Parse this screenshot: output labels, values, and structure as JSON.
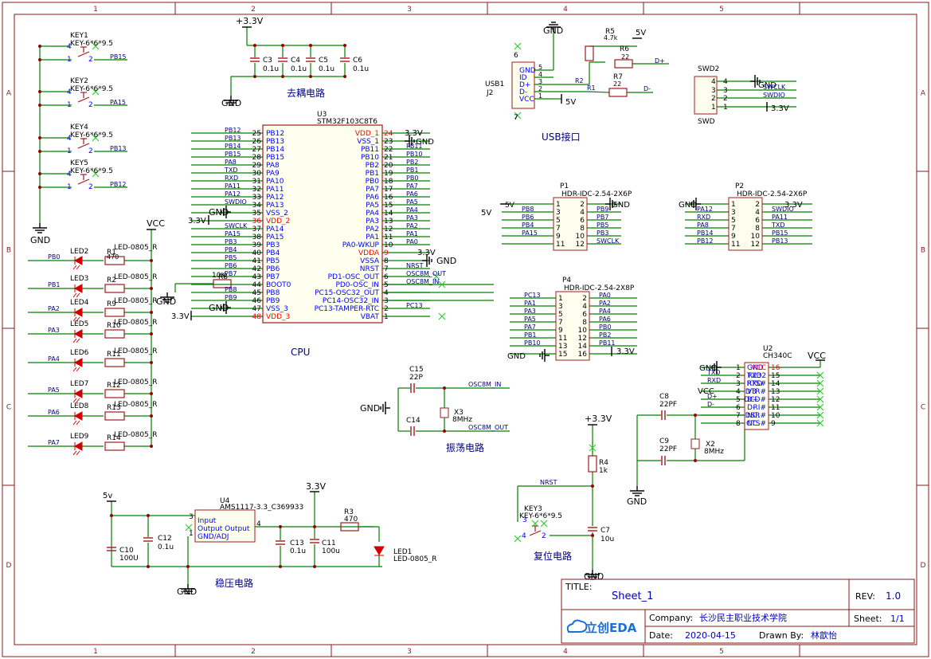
{
  "colors": {
    "frame": "#8b1a1a",
    "wire": "#008000",
    "part": "#a11b1b",
    "pin": "#0000ff",
    "text": "#000000",
    "netlabel": "#000080",
    "power_red": "#ff0000",
    "noconnect": "#33cc33",
    "logo": "#1b6fd6"
  },
  "border": {
    "cols": [
      "1",
      "2",
      "3",
      "4",
      "5"
    ],
    "rows": [
      "A",
      "B",
      "C",
      "D"
    ]
  },
  "title_block": {
    "title_label": "TITLE:",
    "title": "Sheet_1",
    "rev_label": "REV:",
    "rev": "1.0",
    "company_label": "Company:",
    "company": "长沙民主职业技术学院",
    "sheet_label": "Sheet:",
    "sheet": "1/1",
    "date_label": "Date:",
    "date": "2020-04-15",
    "drawn_label": "Drawn By:",
    "drawn_by": "林歆怡",
    "logo_text": "立创EDA"
  },
  "sections": {
    "decoupling": "去耦电路",
    "cpu": "CPU",
    "usb": "USB接口",
    "oscillator": "振荡电路",
    "regulator": "稳压电路",
    "reset": "复位电路"
  },
  "keys": [
    {
      "ref": "KEY1",
      "value": "KEY-6*6*9.5",
      "net": "PB15"
    },
    {
      "ref": "KEY2",
      "value": "KEY-6*6*9.5",
      "net": "PA15"
    },
    {
      "ref": "KEY4",
      "value": "KEY-6*6*9.5",
      "net": "PB13"
    },
    {
      "ref": "KEY5",
      "value": "KEY-6*6*9.5",
      "net": "PB12"
    }
  ],
  "key_gnd": "GND",
  "leds": [
    {
      "ref": "LED2",
      "value": "LED-0805_R",
      "res": "R1",
      "rval": "470",
      "net": "PB0"
    },
    {
      "ref": "LED3",
      "value": "LED-0805_R",
      "res": "R2",
      "rval": "",
      "net": "PB1"
    },
    {
      "ref": "LED4",
      "value": "LED-0805_R",
      "res": "R9",
      "rval": "",
      "net": "PA2"
    },
    {
      "ref": "LED5",
      "value": "LED-0805_R",
      "res": "R10",
      "rval": "",
      "net": "PA3"
    },
    {
      "ref": "LED6",
      "value": "LED-0805_R",
      "res": "R11",
      "rval": "",
      "net": "PA4"
    },
    {
      "ref": "LED7",
      "value": "LED-0805_R",
      "res": "R12",
      "rval": "",
      "net": "PA5"
    },
    {
      "ref": "LED8",
      "value": "LED-0805_R",
      "res": "R13",
      "rval": "",
      "net": "PA6"
    },
    {
      "ref": "LED9",
      "value": "LED-0805_R",
      "res": "R14",
      "rval": "",
      "net": "PA7"
    }
  ],
  "led_vcc": "VCC",
  "caps_decoupling": [
    {
      "ref": "C3",
      "value": "0.1u"
    },
    {
      "ref": "C4",
      "value": "0.1u"
    },
    {
      "ref": "C5",
      "value": "0.1u"
    },
    {
      "ref": "C6",
      "value": "0.1u"
    }
  ],
  "decoupling_power": "+3.3V",
  "decoupling_gnd": "GND",
  "cpu_chip": {
    "ref": "U3",
    "part": "STM32F103C8T6",
    "left_pins": [
      {
        "num": "25",
        "name": "PB12",
        "net": "PB12"
      },
      {
        "num": "26",
        "name": "PB13",
        "net": "PB13"
      },
      {
        "num": "27",
        "name": "PB14",
        "net": "PB14"
      },
      {
        "num": "28",
        "name": "PB15",
        "net": "PB15"
      },
      {
        "num": "29",
        "name": "PA8",
        "net": "PA8"
      },
      {
        "num": "30",
        "name": "PA9",
        "net": "TXD"
      },
      {
        "num": "31",
        "name": "PA10",
        "net": "RXD"
      },
      {
        "num": "32",
        "name": "PA11",
        "net": "PA11"
      },
      {
        "num": "33",
        "name": "PA12",
        "net": "PA12"
      },
      {
        "num": "34",
        "name": "PA13",
        "net": "SWDIO"
      },
      {
        "num": "35",
        "name": "VSS_2",
        "net": "GND"
      },
      {
        "num": "36",
        "name": "VDD_2",
        "net": "3.3V"
      },
      {
        "num": "37",
        "name": "PA14",
        "net": "SWCLK"
      },
      {
        "num": "38",
        "name": "PA15",
        "net": "PA15"
      },
      {
        "num": "39",
        "name": "PB3",
        "net": "PB3"
      },
      {
        "num": "40",
        "name": "PB4",
        "net": "PB4"
      },
      {
        "num": "41",
        "name": "PB5",
        "net": "PB5"
      },
      {
        "num": "42",
        "name": "PB6",
        "net": "PB6"
      },
      {
        "num": "43",
        "name": "PB7",
        "net": "PB7"
      },
      {
        "num": "44",
        "name": "BOOT0",
        "net": ""
      },
      {
        "num": "45",
        "name": "PB8",
        "net": "PB8"
      },
      {
        "num": "46",
        "name": "PB9",
        "net": "PB9"
      },
      {
        "num": "47",
        "name": "VSS_3",
        "net": "GND"
      },
      {
        "num": "48",
        "name": "VDD_3",
        "net": "3.3V"
      }
    ],
    "right_pins": [
      {
        "num": "24",
        "name": "VDD_1",
        "net": "3.3V"
      },
      {
        "num": "23",
        "name": "VSS_1",
        "net": "GND"
      },
      {
        "num": "22",
        "name": "PB11",
        "net": "PB11"
      },
      {
        "num": "21",
        "name": "PB10",
        "net": "PB10"
      },
      {
        "num": "20",
        "name": "PB2",
        "net": "PB2"
      },
      {
        "num": "19",
        "name": "PB1",
        "net": "PB1"
      },
      {
        "num": "18",
        "name": "PB0",
        "net": "PB0"
      },
      {
        "num": "17",
        "name": "PA7",
        "net": "PA7"
      },
      {
        "num": "16",
        "name": "PA6",
        "net": "PA6"
      },
      {
        "num": "15",
        "name": "PA5",
        "net": "PA5"
      },
      {
        "num": "14",
        "name": "PA4",
        "net": "PA4"
      },
      {
        "num": "13",
        "name": "PA3",
        "net": "PA3"
      },
      {
        "num": "12",
        "name": "PA2",
        "net": "PA2"
      },
      {
        "num": "11",
        "name": "PA1",
        "net": "PA1"
      },
      {
        "num": "10",
        "name": "PA0-WKUP",
        "net": "PA0"
      },
      {
        "num": "9",
        "name": "VDDA",
        "net": "3.3V"
      },
      {
        "num": "8",
        "name": "VSSA",
        "net": "GND"
      },
      {
        "num": "7",
        "name": "NRST",
        "net": "NRST"
      },
      {
        "num": "6",
        "name": "PD1-OSC_OUT",
        "net": "OSC8M_OUT"
      },
      {
        "num": "5",
        "name": "PD0-OSC_IN",
        "net": "OSC8M_IN"
      },
      {
        "num": "4",
        "name": "PC15-OSC32_OUT",
        "net": ""
      },
      {
        "num": "3",
        "name": "PC14-OSC32_IN",
        "net": ""
      },
      {
        "num": "2",
        "name": "PC13-TAMPER-RTC",
        "net": "PC13"
      },
      {
        "num": "1",
        "name": "VBAT",
        "net": ""
      }
    ],
    "boot_res": "R8",
    "boot_res_val": "10K",
    "gnd": "GND"
  },
  "usb": {
    "ref": "USB1",
    "conn": "J2",
    "pins": [
      {
        "num": "6",
        "name": "GND"
      },
      {
        "num": "5",
        "name": "GND"
      },
      {
        "num": "4",
        "name": "ID"
      },
      {
        "num": "3",
        "name": "D+"
      },
      {
        "num": "2",
        "name": "D-"
      },
      {
        "num": "1",
        "name": "VCC"
      },
      {
        "num": "7",
        "name": ""
      }
    ],
    "r5": "R5",
    "r5v": "4.7k",
    "r6": "R6",
    "r6v": "22",
    "r7": "R7",
    "r7v": "22",
    "r2": "R2",
    "r1": "R1",
    "dplus": "D+",
    "dminus": "D-",
    "v5": "5V",
    "gnd": "GND"
  },
  "swd": {
    "ref": "SWD2",
    "name": "SWD",
    "pins": [
      {
        "num": "4",
        "net": "GND"
      },
      {
        "num": "3",
        "net": "SWCLK"
      },
      {
        "num": "2",
        "net": "SWDIO"
      },
      {
        "num": "1",
        "net": "3.3V"
      }
    ]
  },
  "p1": {
    "ref": "P1",
    "part": "HDR-IDC-2.54-2X6P",
    "rows": [
      {
        "l": "",
        "ln": "1",
        "rn": "2",
        "r": "GND"
      },
      {
        "l": "PB8",
        "ln": "3",
        "rn": "4",
        "r": "PB9"
      },
      {
        "l": "PB6",
        "ln": "5",
        "rn": "6",
        "r": "PB7"
      },
      {
        "l": "PB4",
        "ln": "7",
        "rn": "8",
        "r": "PB5"
      },
      {
        "l": "PA15",
        "ln": "9",
        "rn": "10",
        "r": "PB3"
      },
      {
        "l": "",
        "ln": "11",
        "rn": "12",
        "r": "SWCLK"
      }
    ],
    "power": "5V"
  },
  "p2": {
    "ref": "P2",
    "part": "HDR-IDC-2.54-2X6P",
    "rows": [
      {
        "l": "GND",
        "ln": "1",
        "rn": "2",
        "r": "3.3V"
      },
      {
        "l": "PA12",
        "ln": "3",
        "rn": "4",
        "r": "SWDIO"
      },
      {
        "l": "RXD",
        "ln": "5",
        "rn": "6",
        "r": "PA11"
      },
      {
        "l": "PA8",
        "ln": "7",
        "rn": "8",
        "r": "TXD"
      },
      {
        "l": "PB14",
        "ln": "9",
        "rn": "10",
        "r": "PB15"
      },
      {
        "l": "PB12",
        "ln": "11",
        "rn": "12",
        "r": "PB13"
      }
    ]
  },
  "p4": {
    "ref": "P4",
    "part": "HDR-IDC-2.54-2X8P",
    "rows": [
      {
        "l": "PC13",
        "ln": "1",
        "rn": "2",
        "r": "PA0"
      },
      {
        "l": "PA1",
        "ln": "3",
        "rn": "4",
        "r": "PA2"
      },
      {
        "l": "PA3",
        "ln": "5",
        "rn": "6",
        "r": "PA4"
      },
      {
        "l": "PA5",
        "ln": "7",
        "rn": "8",
        "r": "PA6"
      },
      {
        "l": "PA7",
        "ln": "9",
        "rn": "10",
        "r": "PB0"
      },
      {
        "l": "PB1",
        "ln": "11",
        "rn": "12",
        "r": "PB2"
      },
      {
        "l": "PB10",
        "ln": "13",
        "rn": "14",
        "r": "PB11"
      },
      {
        "l": "",
        "ln": "15",
        "rn": "16",
        "r": ""
      }
    ],
    "gnd": "GND",
    "power": "3.3V"
  },
  "osc": {
    "c15": "C15",
    "c15v": "22P",
    "c14": "C14",
    "x3": "X3",
    "x3v": "8MHz",
    "in": "OSC8M_IN",
    "out": "OSC8M_OUT",
    "gnd": "GND"
  },
  "ch340": {
    "ref": "U2",
    "part": "CH340C",
    "left": [
      {
        "num": "1",
        "name": "GND",
        "net": "GND"
      },
      {
        "num": "2",
        "name": "TXD",
        "net": "TXD"
      },
      {
        "num": "3",
        "name": "RXD",
        "net": "RXD"
      },
      {
        "num": "4",
        "name": "V3",
        "net": "VCC"
      },
      {
        "num": "5",
        "name": "D+",
        "net": "D+"
      },
      {
        "num": "6",
        "name": "D-",
        "net": "D-"
      },
      {
        "num": "7",
        "name": "NC.",
        "net": ""
      },
      {
        "num": "8",
        "name": "NC.",
        "net": ""
      }
    ],
    "right": [
      {
        "num": "16",
        "name": "VCC"
      },
      {
        "num": "15",
        "name": "R232"
      },
      {
        "num": "14",
        "name": "RTS#"
      },
      {
        "num": "13",
        "name": "DTR#"
      },
      {
        "num": "12",
        "name": "DCD#"
      },
      {
        "num": "11",
        "name": "RI#"
      },
      {
        "num": "10",
        "name": "DSR#"
      },
      {
        "num": "9",
        "name": "CTS#"
      }
    ],
    "vcc": "VCC",
    "c8": "C8",
    "c8v": "22PF",
    "c9": "C9",
    "c9v": "22PF",
    "x2": "X2",
    "x2v": "8MHz",
    "gnd": "GND"
  },
  "reset": {
    "power": "+3.3V",
    "r4": "R4",
    "r4v": "1k",
    "nrst": "NRST",
    "key": "KEY3",
    "keyv": "KEY-6*6*9.5",
    "c7": "C7",
    "c7v": "10u",
    "gnd": "GND"
  },
  "regulator": {
    "vin": "5v",
    "ref": "U4",
    "part": "AMS1117-3.3_C369933",
    "pin_input": "Input",
    "pin_output": "Output Output",
    "pin_gnd": "GND/ADJ",
    "c10": "C10",
    "c10v": "100U",
    "c12": "C12",
    "c12v": "0.1u",
    "c13": "C13",
    "c13v": "0.1u",
    "c11": "C11",
    "c11v": "100u",
    "r3": "R3",
    "r3v": "470",
    "led": "LED1",
    "ledv": "LED-0805_R",
    "vout": "3.3V",
    "gnd": "GND"
  }
}
